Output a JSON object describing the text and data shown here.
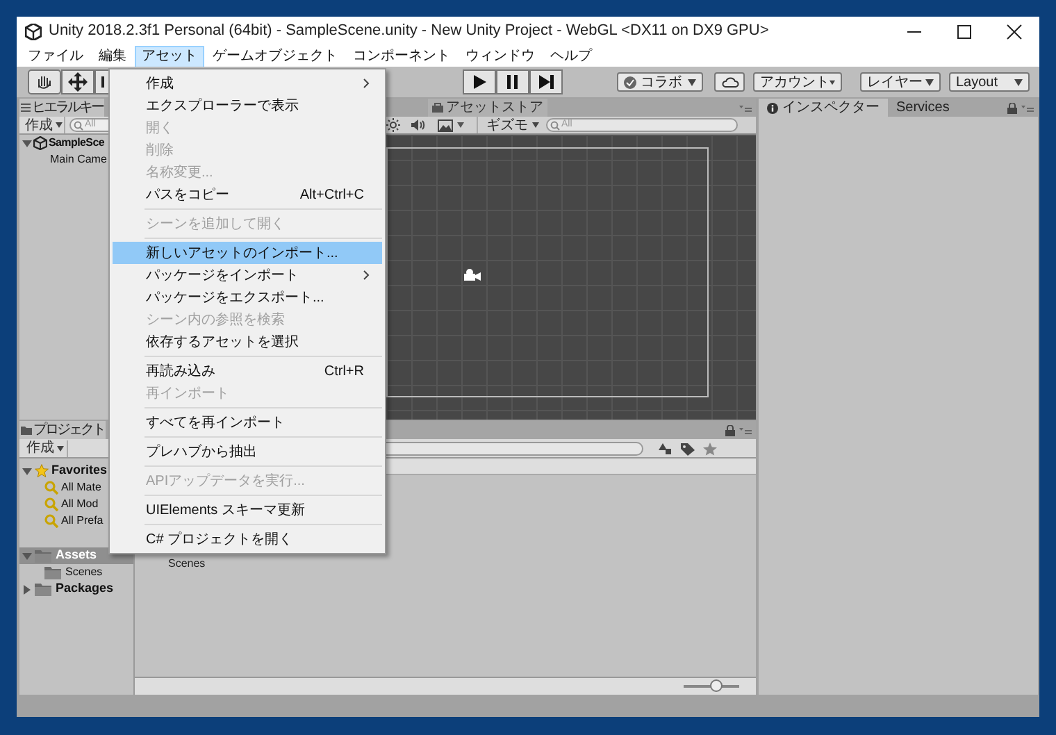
{
  "window": {
    "title": "Unity 2018.2.3f1 Personal (64bit) - SampleScene.unity - New Unity Project - WebGL <DX11 on DX9 GPU>"
  },
  "menu_bar": [
    {
      "label": "ファイル",
      "selected": false
    },
    {
      "label": "編集",
      "selected": false
    },
    {
      "label": "アセット",
      "selected": true
    },
    {
      "label": "ゲームオブジェクト",
      "selected": false
    },
    {
      "label": "コンポーネント",
      "selected": false
    },
    {
      "label": "ウィンドウ",
      "selected": false
    },
    {
      "label": "ヘルプ",
      "selected": false
    }
  ],
  "toolbar": {
    "right_buttons": [
      {
        "kind": "collab",
        "label": "コラボ"
      },
      {
        "kind": "cloud"
      },
      {
        "kind": "dropdown",
        "label": "アカウント"
      },
      {
        "kind": "dropdown",
        "label": "レイヤー"
      },
      {
        "kind": "dropdown",
        "label": "Layout"
      }
    ]
  },
  "hierarchy": {
    "title": "ヒエラルキー",
    "create": "作成",
    "search_placeholder": "All",
    "items": [
      {
        "label": "SampleSce",
        "expanded": true,
        "children": [
          {
            "label": "Main Came"
          }
        ]
      }
    ]
  },
  "scene": {
    "tab": "アセットストア",
    "gizmos": "ギズモ",
    "search_placeholder": "All"
  },
  "inspector": {
    "tabs": [
      {
        "label": "インスペクター",
        "selected": true
      },
      {
        "label": "Services",
        "selected": false
      }
    ]
  },
  "project": {
    "title": "プロジェクト",
    "create": "作成",
    "tree": [
      {
        "label": "Favorites",
        "kind": "favorites",
        "expanded": true,
        "selected": false,
        "children": [
          {
            "label": "All Mate"
          },
          {
            "label": "All Mod"
          },
          {
            "label": "All Prefa"
          }
        ]
      },
      {
        "label": "Assets",
        "kind": "folder",
        "expanded": true,
        "selected": true,
        "children": [
          {
            "label": "Scenes"
          }
        ]
      },
      {
        "label": "Packages",
        "kind": "folder",
        "expanded": false,
        "selected": false
      }
    ],
    "content": [
      {
        "label": "Scenes"
      }
    ],
    "zoom_slider": {
      "level": 0.58
    }
  },
  "dropdown_menu": [
    {
      "kind": "item",
      "label": "作成",
      "submenu": true,
      "disabled": false,
      "selected": false
    },
    {
      "kind": "item",
      "label": "エクスプローラーで表示",
      "disabled": false,
      "selected": false
    },
    {
      "kind": "item",
      "label": "開く",
      "disabled": true,
      "selected": false
    },
    {
      "kind": "item",
      "label": "削除",
      "disabled": true,
      "selected": false
    },
    {
      "kind": "item",
      "label": "名称変更...",
      "disabled": true,
      "selected": false
    },
    {
      "kind": "item",
      "label": "パスをコピー",
      "shortcut": "Alt+Ctrl+C",
      "disabled": false,
      "selected": false
    },
    {
      "kind": "separator"
    },
    {
      "kind": "item",
      "label": "シーンを追加して開く",
      "disabled": true,
      "selected": false
    },
    {
      "kind": "separator"
    },
    {
      "kind": "item",
      "label": "新しいアセットのインポート...",
      "disabled": false,
      "selected": true
    },
    {
      "kind": "item",
      "label": "パッケージをインポート",
      "submenu": true,
      "disabled": false,
      "selected": false
    },
    {
      "kind": "item",
      "label": "パッケージをエクスポート...",
      "disabled": false,
      "selected": false
    },
    {
      "kind": "item",
      "label": "シーン内の参照を検索",
      "disabled": true,
      "selected": false
    },
    {
      "kind": "item",
      "label": "依存するアセットを選択",
      "disabled": false,
      "selected": false
    },
    {
      "kind": "separator"
    },
    {
      "kind": "item",
      "label": "再読み込み",
      "shortcut": "Ctrl+R",
      "disabled": false,
      "selected": false
    },
    {
      "kind": "item",
      "label": "再インポート",
      "disabled": true,
      "selected": false
    },
    {
      "kind": "separator"
    },
    {
      "kind": "item",
      "label": "すべてを再インポート",
      "disabled": false,
      "selected": false
    },
    {
      "kind": "separator"
    },
    {
      "kind": "item",
      "label": "プレハブから抽出",
      "disabled": false,
      "selected": false
    },
    {
      "kind": "separator"
    },
    {
      "kind": "item",
      "label": "APIアップデータを実行...",
      "disabled": true,
      "selected": false
    },
    {
      "kind": "separator"
    },
    {
      "kind": "item",
      "label": "UIElements スキーマ更新",
      "disabled": false,
      "selected": false
    },
    {
      "kind": "separator"
    },
    {
      "kind": "item",
      "label": "C# プロジェクトを開く",
      "disabled": false,
      "selected": false
    }
  ]
}
